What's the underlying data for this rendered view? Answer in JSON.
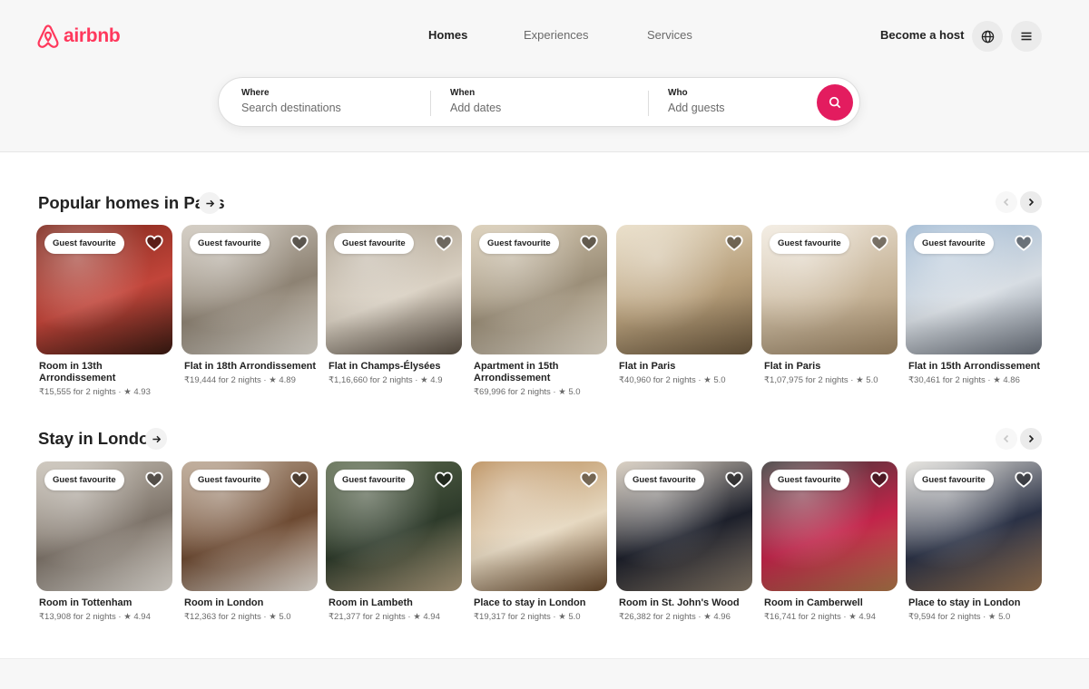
{
  "brand": {
    "name": "airbnb",
    "color": "#ff385c"
  },
  "nav": {
    "tabs": [
      {
        "label": "Homes",
        "active": true
      },
      {
        "label": "Experiences",
        "active": false
      },
      {
        "label": "Services",
        "active": false
      }
    ],
    "become_host": "Become a host",
    "globe_icon": "globe-icon",
    "menu_icon": "hamburger-menu-icon"
  },
  "search": {
    "where": {
      "label": "Where",
      "placeholder": "Search destinations"
    },
    "when": {
      "label": "When",
      "placeholder": "Add dates"
    },
    "who": {
      "label": "Who",
      "placeholder": "Add guests"
    },
    "button_icon": "search-icon",
    "button_color": "#e31c5f"
  },
  "sections": [
    {
      "title": "Popular homes in Paris",
      "listings": [
        {
          "badge": "Guest favourite",
          "title": "Room in 13th Arrondissement",
          "price": "₹15,555 for 2 nights",
          "rating": "4.93"
        },
        {
          "badge": "Guest favourite",
          "title": "Flat in 18th Arrondissement",
          "price": "₹19,444 for 2 nights",
          "rating": "4.89"
        },
        {
          "badge": "Guest favourite",
          "title": "Flat in Champs-Élysées",
          "price": "₹1,16,660 for 2 nights",
          "rating": "4.9"
        },
        {
          "badge": "Guest favourite",
          "title": "Apartment in 15th Arrondissement",
          "price": "₹69,996 for 2 nights",
          "rating": "5.0"
        },
        {
          "badge": "",
          "title": "Flat in Paris",
          "price": "₹40,960 for 2 nights",
          "rating": "5.0"
        },
        {
          "badge": "Guest favourite",
          "title": "Flat in Paris",
          "price": "₹1,07,975 for 2 nights",
          "rating": "5.0"
        },
        {
          "badge": "Guest favourite",
          "title": "Flat in 15th Arrondissement",
          "price": "₹30,461 for 2 nights",
          "rating": "4.86"
        }
      ]
    },
    {
      "title": "Stay in London",
      "listings": [
        {
          "badge": "Guest favourite",
          "title": "Room in Tottenham",
          "price": "₹13,908 for 2 nights",
          "rating": "4.94"
        },
        {
          "badge": "Guest favourite",
          "title": "Room in London",
          "price": "₹12,363 for 2 nights",
          "rating": "5.0"
        },
        {
          "badge": "Guest favourite",
          "title": "Room in Lambeth",
          "price": "₹21,377 for 2 nights",
          "rating": "4.94"
        },
        {
          "badge": "",
          "title": "Place to stay in London",
          "price": "₹19,317 for 2 nights",
          "rating": "5.0"
        },
        {
          "badge": "Guest favourite",
          "title": "Room in St. John's Wood",
          "price": "₹26,382 for 2 nights",
          "rating": "4.96"
        },
        {
          "badge": "Guest favourite",
          "title": "Room in Camberwell",
          "price": "₹16,741 for 2 nights",
          "rating": "4.94"
        },
        {
          "badge": "Guest favourite",
          "title": "Place to stay in London",
          "price": "₹9,594 for 2 nights",
          "rating": "5.0"
        }
      ]
    }
  ],
  "photo_palettes": [
    [
      "#7a2418",
      "#c2453a",
      "#3a1b12"
    ],
    [
      "#cfc8bd",
      "#8d8273",
      "#e9e4da"
    ],
    [
      "#a89c8a",
      "#d9d0c2",
      "#5d5246"
    ],
    [
      "#d8cbb3",
      "#9b8e78",
      "#f0e7d6"
    ],
    [
      "#e8dcc4",
      "#b79f7b",
      "#6e5a3f"
    ],
    [
      "#f2ebe0",
      "#c9b79c",
      "#a38a68"
    ],
    [
      "#9db7d1",
      "#d7dde3",
      "#6e7580"
    ],
    [
      "#c9c2b7",
      "#7d7369",
      "#ece7df"
    ],
    [
      "#b9a48f",
      "#6d4a32",
      "#efe8df"
    ],
    [
      "#5d6b4e",
      "#2d3a2a",
      "#b4a282"
    ],
    [
      "#b88a55",
      "#e6d8c0",
      "#6a4a2c"
    ],
    [
      "#d7ccbd",
      "#1c1f2a",
      "#8a7c6b"
    ],
    [
      "#3a3837",
      "#c2244a",
      "#b17a4a"
    ],
    [
      "#e4e2dc",
      "#2a3145",
      "#9a7654"
    ]
  ]
}
